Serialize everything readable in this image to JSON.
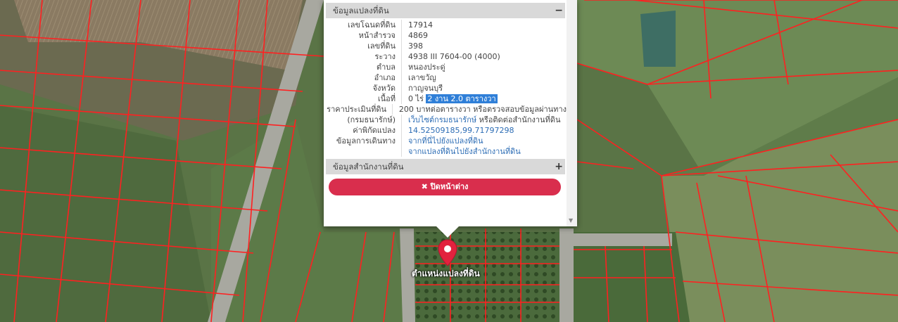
{
  "popup": {
    "section_parcel_title": "ข้อมูลแปลงที่ดิน",
    "section_parcel_toggle": "−",
    "section_office_title": "ข้อมูลสำนักงานที่ดิน",
    "section_office_toggle": "+",
    "rows": [
      {
        "label": "เลขโฉนดที่ดิน",
        "value": "17914"
      },
      {
        "label": "หน้าสำรวจ",
        "value": "4869"
      },
      {
        "label": "เลขที่ดิน",
        "value": "398"
      },
      {
        "label": "ระวาง",
        "value": "4938 III 7604-00 (4000)"
      },
      {
        "label": "ตำบล",
        "value": "หนองประดู่"
      },
      {
        "label": "อำเภอ",
        "value": "เลาขวัญ"
      },
      {
        "label": "จังหวัด",
        "value": "กาญจนบุรี"
      }
    ],
    "area": {
      "label": "เนื้อที่",
      "prefix": "0 ไร่",
      "highlight": "2 งาน 2.0 ตารางวา"
    },
    "price": {
      "label": "ราคาประเมินที่ดิน",
      "value": "200 บาทต่อตารางวา หรือตรวจสอบข้อมูลผ่านทาง"
    },
    "dept": {
      "label": "(กรมธนารักษ์)",
      "link": "เว็บไซต์กรมธนารักษ์",
      "suffix": "หรือติดต่อสำนักงานที่ดิน"
    },
    "coords": {
      "label": "ค่าพิกัดแปลง",
      "value": "14.52509185,99.71797298"
    },
    "route": {
      "label": "ข้อมูลการเดินทาง",
      "link1": "จากที่นี่ไปยังแปลงที่ดิน",
      "link2": "จากแปลงที่ดินไปยังสำนักงานที่ดิน"
    },
    "close_label": "✖ ปิดหน้าต่าง"
  },
  "marker": {
    "label": "ตำแหน่งแปลงที่ดิน",
    "color": "#e2223e"
  },
  "colors": {
    "parcel_line": "#ff2020",
    "road": "#a8a8a0"
  }
}
